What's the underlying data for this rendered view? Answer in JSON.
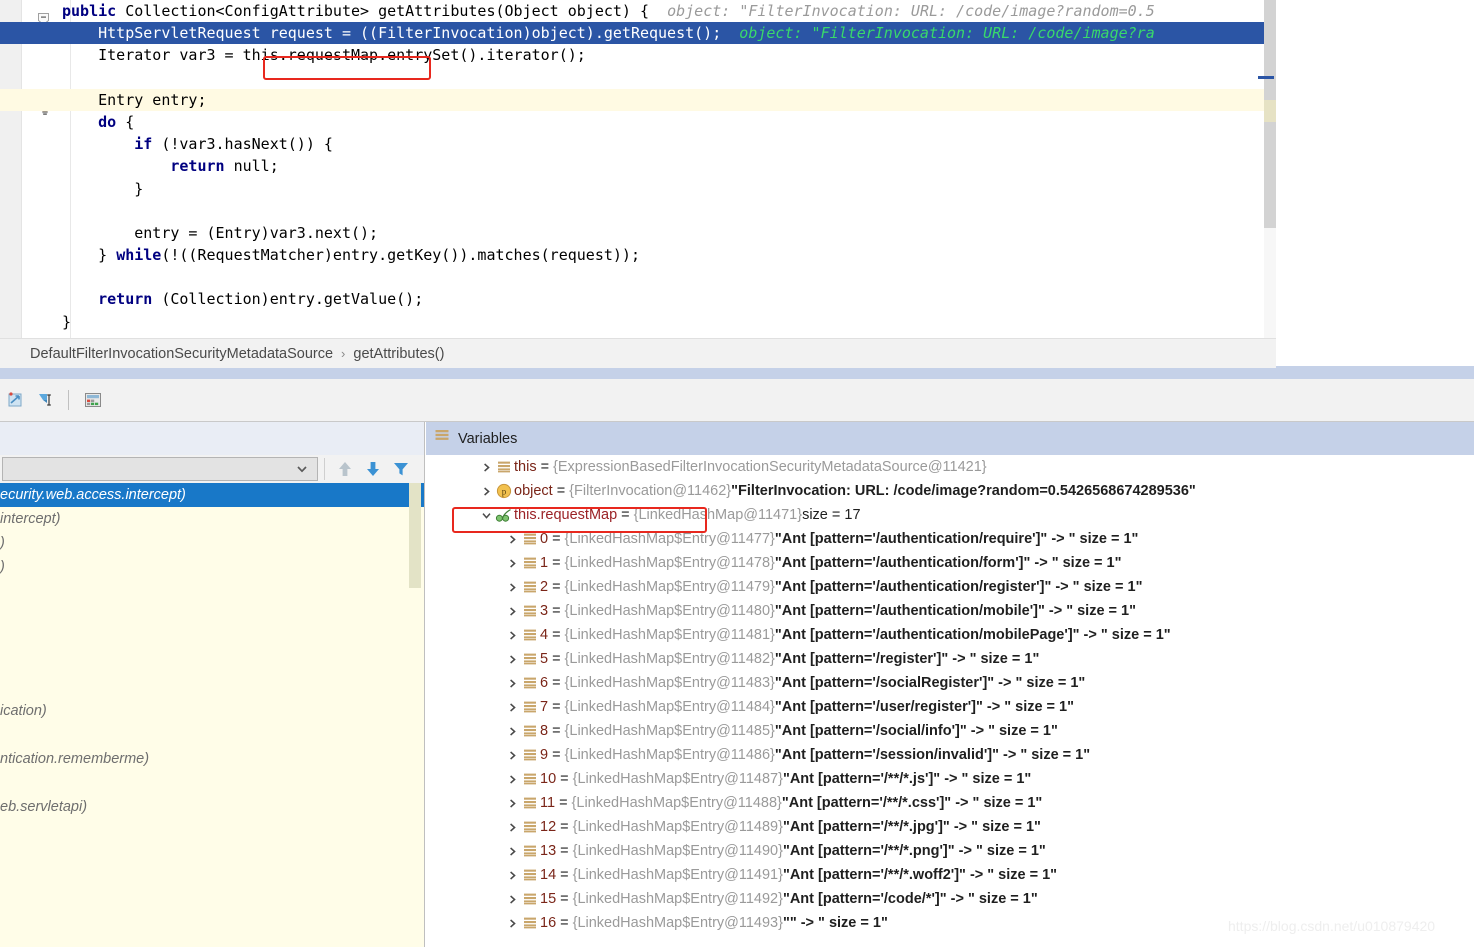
{
  "editor": {
    "lines": [
      {
        "indent": 0,
        "segments": [
          {
            "t": "kw",
            "s": "public"
          },
          {
            "t": "p",
            "s": " Collection<ConfigAttribute> getAttributes(Object object) {"
          },
          {
            "t": "hint",
            "s": "  object: \"FilterInvocation: URL: /code/image?random=0.5"
          }
        ],
        "style": "normal"
      },
      {
        "indent": 0,
        "segments": [
          {
            "t": "p",
            "s": "    HttpServletRequest request = ((FilterInvocation)object).getRequest();"
          },
          {
            "t": "hint",
            "s": "  object: \"FilterInvocation: URL: /code/image?ra"
          }
        ],
        "style": "highlight"
      },
      {
        "indent": 0,
        "segments": [
          {
            "t": "p",
            "s": "    Iterator var3 = this.requestMap.entrySet().iterator();"
          }
        ],
        "style": "normal"
      },
      {
        "indent": 0,
        "segments": [
          {
            "t": "p",
            "s": ""
          }
        ],
        "style": "normal"
      },
      {
        "indent": 0,
        "segments": [
          {
            "t": "p",
            "s": "    Entry entry;"
          }
        ],
        "style": "warn"
      },
      {
        "indent": 0,
        "segments": [
          {
            "t": "kw",
            "s": "    do"
          },
          {
            "t": "p",
            "s": " {"
          }
        ],
        "style": "normal"
      },
      {
        "indent": 0,
        "segments": [
          {
            "t": "p",
            "s": "        "
          },
          {
            "t": "kw",
            "s": "if"
          },
          {
            "t": "p",
            "s": " (!var3.hasNext()) {"
          }
        ],
        "style": "normal"
      },
      {
        "indent": 0,
        "segments": [
          {
            "t": "p",
            "s": "            "
          },
          {
            "t": "kw",
            "s": "return"
          },
          {
            "t": "p",
            "s": " null;"
          }
        ],
        "style": "normal"
      },
      {
        "indent": 0,
        "segments": [
          {
            "t": "p",
            "s": "        }"
          }
        ],
        "style": "normal"
      },
      {
        "indent": 0,
        "segments": [
          {
            "t": "p",
            "s": ""
          }
        ],
        "style": "normal"
      },
      {
        "indent": 0,
        "segments": [
          {
            "t": "p",
            "s": "        entry = (Entry)var3.next();"
          }
        ],
        "style": "normal"
      },
      {
        "indent": 0,
        "segments": [
          {
            "t": "p",
            "s": "    } "
          },
          {
            "t": "kw",
            "s": "while"
          },
          {
            "t": "p",
            "s": "(!((RequestMatcher)entry.getKey()).matches(request));"
          }
        ],
        "style": "normal"
      },
      {
        "indent": 0,
        "segments": [
          {
            "t": "p",
            "s": ""
          }
        ],
        "style": "normal"
      },
      {
        "indent": 0,
        "segments": [
          {
            "t": "p",
            "s": "    "
          },
          {
            "t": "kw",
            "s": "return"
          },
          {
            "t": "p",
            "s": " (Collection)entry.getValue();"
          }
        ],
        "style": "normal"
      },
      {
        "indent": 0,
        "segments": [
          {
            "t": "p",
            "s": "}"
          }
        ],
        "style": "normal"
      }
    ]
  },
  "breadcrumb": {
    "class_name": "DefaultFilterInvocationSecurityMetadataSource",
    "separator": "›",
    "method_name": "getAttributes()"
  },
  "debug_toolbar": {
    "buttons": [
      {
        "name": "restore-layout-icon",
        "label": ""
      },
      {
        "name": "mute-breakpoints-icon",
        "label": ""
      },
      {
        "name": "settings-icon",
        "label": ""
      }
    ]
  },
  "frames": {
    "thread_selector_value": "",
    "controls": [
      {
        "name": "frame-up-button",
        "label": "↑"
      },
      {
        "name": "frame-down-button",
        "label": "↓"
      },
      {
        "name": "filter-frames-button",
        "label": "filter"
      }
    ],
    "rows": [
      {
        "text": "ecurity.web.access.intercept)",
        "selected": true
      },
      {
        "text": "intercept)",
        "selected": false
      },
      {
        "text": ")",
        "selected": false
      },
      {
        "text": ")",
        "selected": false
      },
      {
        "text": "",
        "selected": false
      },
      {
        "text": "",
        "selected": false
      },
      {
        "text": "",
        "selected": false
      },
      {
        "text": "",
        "selected": false
      },
      {
        "text": "",
        "selected": false
      },
      {
        "text": "ication)",
        "selected": false
      },
      {
        "text": "",
        "selected": false
      },
      {
        "text": "ntication.rememberme)",
        "selected": false
      },
      {
        "text": "",
        "selected": false
      },
      {
        "text": "eb.servletapi)",
        "selected": false
      }
    ]
  },
  "watch_toolbar": {
    "buttons": [
      {
        "name": "add-watch-button"
      },
      {
        "name": "remove-watch-button"
      },
      {
        "name": "move-watch-up-button"
      },
      {
        "name": "move-watch-down-button"
      },
      {
        "name": "copy-value-button"
      },
      {
        "name": "inspect-watch-button"
      }
    ]
  },
  "variables": {
    "title": "Variables",
    "rows": [
      {
        "level": 1,
        "expanded": false,
        "icon": "object-icon",
        "name": "this",
        "type": "{ExpressionBasedFilterInvocationSecurityMetadataSource@11421}",
        "value": "",
        "suffix": ""
      },
      {
        "level": 1,
        "expanded": false,
        "icon": "parameter-icon",
        "name": "object",
        "type": "{FilterInvocation@11462}",
        "value": "\"FilterInvocation: URL: /code/image?random=0.5426568674289536\"",
        "suffix": ""
      },
      {
        "level": 1,
        "expanded": true,
        "icon": "watch-icon",
        "name": "this.requestMap",
        "type": "{LinkedHashMap@11471}",
        "value": "",
        "suffix": "size = 17",
        "highlighted": true
      },
      {
        "level": 2,
        "expanded": false,
        "icon": "entry-icon",
        "name": "0",
        "type": "{LinkedHashMap$Entry@11477}",
        "value": "\"Ant [pattern='/authentication/require']\" -> \" size = 1\"",
        "suffix": ""
      },
      {
        "level": 2,
        "expanded": false,
        "icon": "entry-icon",
        "name": "1",
        "type": "{LinkedHashMap$Entry@11478}",
        "value": "\"Ant [pattern='/authentication/form']\" -> \" size = 1\"",
        "suffix": ""
      },
      {
        "level": 2,
        "expanded": false,
        "icon": "entry-icon",
        "name": "2",
        "type": "{LinkedHashMap$Entry@11479}",
        "value": "\"Ant [pattern='/authentication/register']\" -> \" size = 1\"",
        "suffix": ""
      },
      {
        "level": 2,
        "expanded": false,
        "icon": "entry-icon",
        "name": "3",
        "type": "{LinkedHashMap$Entry@11480}",
        "value": "\"Ant [pattern='/authentication/mobile']\" -> \" size = 1\"",
        "suffix": ""
      },
      {
        "level": 2,
        "expanded": false,
        "icon": "entry-icon",
        "name": "4",
        "type": "{LinkedHashMap$Entry@11481}",
        "value": "\"Ant [pattern='/authentication/mobilePage']\" -> \" size = 1\"",
        "suffix": ""
      },
      {
        "level": 2,
        "expanded": false,
        "icon": "entry-icon",
        "name": "5",
        "type": "{LinkedHashMap$Entry@11482}",
        "value": "\"Ant [pattern='/register']\" -> \" size = 1\"",
        "suffix": ""
      },
      {
        "level": 2,
        "expanded": false,
        "icon": "entry-icon",
        "name": "6",
        "type": "{LinkedHashMap$Entry@11483}",
        "value": "\"Ant [pattern='/socialRegister']\" -> \" size = 1\"",
        "suffix": ""
      },
      {
        "level": 2,
        "expanded": false,
        "icon": "entry-icon",
        "name": "7",
        "type": "{LinkedHashMap$Entry@11484}",
        "value": "\"Ant [pattern='/user/register']\" -> \" size = 1\"",
        "suffix": ""
      },
      {
        "level": 2,
        "expanded": false,
        "icon": "entry-icon",
        "name": "8",
        "type": "{LinkedHashMap$Entry@11485}",
        "value": "\"Ant [pattern='/social/info']\" -> \" size = 1\"",
        "suffix": ""
      },
      {
        "level": 2,
        "expanded": false,
        "icon": "entry-icon",
        "name": "9",
        "type": "{LinkedHashMap$Entry@11486}",
        "value": "\"Ant [pattern='/session/invalid']\" -> \" size = 1\"",
        "suffix": ""
      },
      {
        "level": 2,
        "expanded": false,
        "icon": "entry-icon",
        "name": "10",
        "type": "{LinkedHashMap$Entry@11487}",
        "value": "\"Ant [pattern='/**/*.js']\" -> \" size = 1\"",
        "suffix": ""
      },
      {
        "level": 2,
        "expanded": false,
        "icon": "entry-icon",
        "name": "11",
        "type": "{LinkedHashMap$Entry@11488}",
        "value": "\"Ant [pattern='/**/*.css']\" -> \" size = 1\"",
        "suffix": ""
      },
      {
        "level": 2,
        "expanded": false,
        "icon": "entry-icon",
        "name": "12",
        "type": "{LinkedHashMap$Entry@11489}",
        "value": "\"Ant [pattern='/**/*.jpg']\" -> \" size = 1\"",
        "suffix": ""
      },
      {
        "level": 2,
        "expanded": false,
        "icon": "entry-icon",
        "name": "13",
        "type": "{LinkedHashMap$Entry@11490}",
        "value": "\"Ant [pattern='/**/*.png']\" -> \" size = 1\"",
        "suffix": ""
      },
      {
        "level": 2,
        "expanded": false,
        "icon": "entry-icon",
        "name": "14",
        "type": "{LinkedHashMap$Entry@11491}",
        "value": "\"Ant [pattern='/**/*.woff2']\" -> \" size = 1\"",
        "suffix": ""
      },
      {
        "level": 2,
        "expanded": false,
        "icon": "entry-icon",
        "name": "15",
        "type": "{LinkedHashMap$Entry@11492}",
        "value": "\"Ant [pattern='/code/*']\" -> \" size = 1\"",
        "suffix": ""
      },
      {
        "level": 2,
        "expanded": false,
        "icon": "entry-icon",
        "name": "16",
        "type": "{LinkedHashMap$Entry@11493}",
        "value": "\"\" -> \" size = 1\"",
        "suffix": ""
      }
    ]
  },
  "watermark": {
    "text": "https://blog.csdn.net/u010879420"
  },
  "colors": {
    "selection_blue": "#2b55a5",
    "frame_selected_blue": "#1878c8",
    "annotation_red": "#e8281e",
    "hint_green": "#39d96b",
    "keyword_navy": "#000080",
    "panel_header_blue": "#c5d1e8",
    "frames_bg_cream": "#fffde8",
    "warn_line": "#fffae3"
  }
}
